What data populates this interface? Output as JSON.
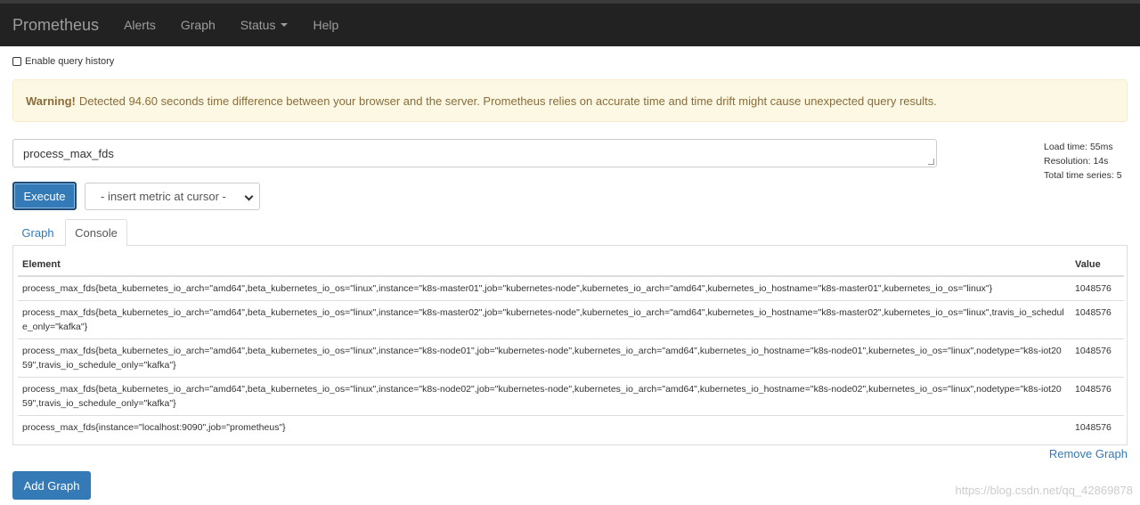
{
  "navbar": {
    "brand": "Prometheus",
    "items": [
      "Alerts",
      "Graph",
      "Status",
      "Help"
    ]
  },
  "query_history": {
    "label": "Enable query history",
    "checked": false
  },
  "warning": {
    "title": "Warning!",
    "message": "Detected 94.60 seconds time difference between your browser and the server. Prometheus relies on accurate time and time drift might cause unexpected query results."
  },
  "expression": {
    "value": "process_max_fds"
  },
  "stats": {
    "load_time": "Load time: 55ms",
    "resolution": "Resolution: 14s",
    "total_series": "Total time series: 5"
  },
  "execute_label": "Execute",
  "metric_select": {
    "selected": "- insert metric at cursor -"
  },
  "tabs": [
    {
      "label": "Graph",
      "active": false
    },
    {
      "label": "Console",
      "active": true
    }
  ],
  "table": {
    "headers": [
      "Element",
      "Value"
    ],
    "rows": [
      {
        "element": "process_max_fds{beta_kubernetes_io_arch=\"amd64\",beta_kubernetes_io_os=\"linux\",instance=\"k8s-master01\",job=\"kubernetes-node\",kubernetes_io_arch=\"amd64\",kubernetes_io_hostname=\"k8s-master01\",kubernetes_io_os=\"linux\"}",
        "value": "1048576"
      },
      {
        "element": "process_max_fds{beta_kubernetes_io_arch=\"amd64\",beta_kubernetes_io_os=\"linux\",instance=\"k8s-master02\",job=\"kubernetes-node\",kubernetes_io_arch=\"amd64\",kubernetes_io_hostname=\"k8s-master02\",kubernetes_io_os=\"linux\",travis_io_schedule_only=\"kafka\"}",
        "value": "1048576"
      },
      {
        "element": "process_max_fds{beta_kubernetes_io_arch=\"amd64\",beta_kubernetes_io_os=\"linux\",instance=\"k8s-node01\",job=\"kubernetes-node\",kubernetes_io_arch=\"amd64\",kubernetes_io_hostname=\"k8s-node01\",kubernetes_io_os=\"linux\",nodetype=\"k8s-iot2059\",travis_io_schedule_only=\"kafka\"}",
        "value": "1048576"
      },
      {
        "element": "process_max_fds{beta_kubernetes_io_arch=\"amd64\",beta_kubernetes_io_os=\"linux\",instance=\"k8s-node02\",job=\"kubernetes-node\",kubernetes_io_arch=\"amd64\",kubernetes_io_hostname=\"k8s-node02\",kubernetes_io_os=\"linux\",nodetype=\"k8s-iot2059\",travis_io_schedule_only=\"kafka\"}",
        "value": "1048576"
      },
      {
        "element": "process_max_fds{instance=\"localhost:9090\",job=\"prometheus\"}",
        "value": "1048576"
      }
    ]
  },
  "remove_graph_label": "Remove Graph",
  "add_graph_label": "Add Graph",
  "watermark": "https://blog.csdn.net/qq_42869878",
  "colors": {
    "navbar_bg": "#222222",
    "primary": "#337ab7",
    "warning_bg": "#fcf8e3",
    "warning_text": "#8a6d3b"
  }
}
